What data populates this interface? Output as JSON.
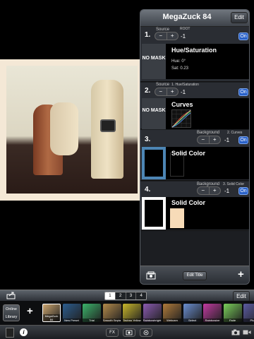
{
  "panel": {
    "title": "MegaZuck 84",
    "edit_label": "Edit",
    "edit_title_label": "Edit Title"
  },
  "layers": [
    {
      "number": "1.",
      "source_label": "Source",
      "source_name": "ROOT",
      "value": "-1",
      "on_label": "On",
      "mask_label": "NO MASK",
      "effect": "Hue/Saturation",
      "details": [
        "Hue: 0°",
        "Sat: 0.23"
      ]
    },
    {
      "number": "2.",
      "source_label": "Source",
      "source_name": "1. Hue/Saturation",
      "value": "-1",
      "on_label": "On",
      "mask_label": "NO MASK",
      "effect": "Curves"
    },
    {
      "number": "3.",
      "source_label": "Background",
      "source_name": "2. Curves",
      "value": "-1",
      "on_label": "On",
      "effect": "Solid Color",
      "swatch_color": "#4d86b5"
    },
    {
      "number": "4.",
      "source_label": "Background",
      "source_name": "3. Solid Color",
      "value": "-1",
      "on_label": "On",
      "effect": "Solid Color",
      "swatch_color": "#f7dbb8"
    }
  ],
  "toolbar": {
    "edit_label": "Edit",
    "segments": [
      "1",
      "2",
      "3",
      "4"
    ]
  },
  "strip": {
    "online_library": "Online Library",
    "plus": "+",
    "presets": [
      {
        "name": "MegaZuck 84",
        "color": "#caa46e"
      },
      {
        "name": "New Preset",
        "color": "#2b5c8e"
      },
      {
        "name": "Trial",
        "color": "#3bb36a"
      },
      {
        "name": "Smooth Sepia",
        "color": "#b38a4a"
      },
      {
        "name": "Techno Yellow",
        "color": "#c7b62a"
      },
      {
        "name": "Rainbowbright",
        "color": "#8a5ab0"
      },
      {
        "name": "Webcam",
        "color": "#b07a3a"
      },
      {
        "name": "Select",
        "color": "#6a8ed0"
      },
      {
        "name": "Rainbowize",
        "color": "#c03aa0"
      },
      {
        "name": "Fade",
        "color": "#7acf5a"
      },
      {
        "name": "Pha",
        "color": "#5a5aa0"
      }
    ]
  },
  "bottom": {
    "fx_label": "FX"
  },
  "colors": {
    "accent": "#2a62c9",
    "panel": "#1c1e22"
  }
}
